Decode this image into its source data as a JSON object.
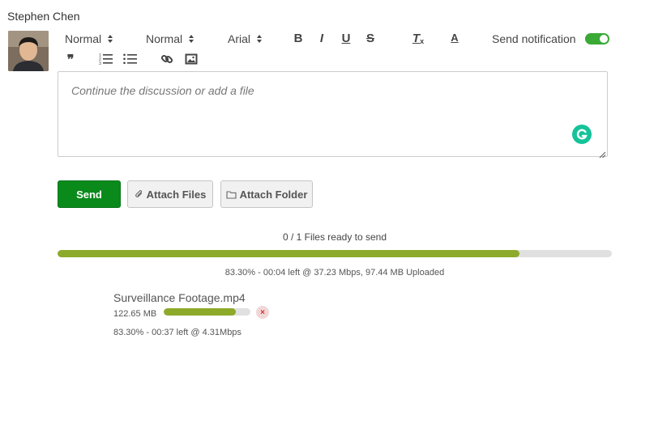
{
  "user": {
    "name": "Stephen Chen"
  },
  "toolbar": {
    "heading_select": "Normal",
    "size_select": "Normal",
    "font_select": "Arial",
    "bold_label": "B",
    "italic_label": "I",
    "underline_label": "U",
    "strike_label": "S",
    "clear_format_label": "T",
    "font_color_label": "A",
    "quote_label": "❞"
  },
  "notification": {
    "label": "Send notification",
    "enabled": true
  },
  "editor": {
    "placeholder": "Continue the discussion or add a file"
  },
  "actions": {
    "send_label": "Send",
    "attach_files_label": "Attach Files",
    "attach_folder_label": "Attach Folder"
  },
  "upload": {
    "summary": "0 / 1 Files ready to send",
    "overall_progress": 0.833,
    "overall_status": "83.30% - 00:04 left @ 37.23 Mbps, 97.44 MB Uploaded",
    "files": [
      {
        "name": "Surveillance Footage.mp4",
        "size": "122.65 MB",
        "progress": 0.833,
        "status": "83.30% - 00:37 left @ 4.31Mbps",
        "remove_label": "×"
      }
    ]
  },
  "colors": {
    "accent_green": "#0b8a1c",
    "progress_green": "#8daa2a",
    "toggle_green": "#3aa935",
    "remove_red": "#d9302c"
  }
}
